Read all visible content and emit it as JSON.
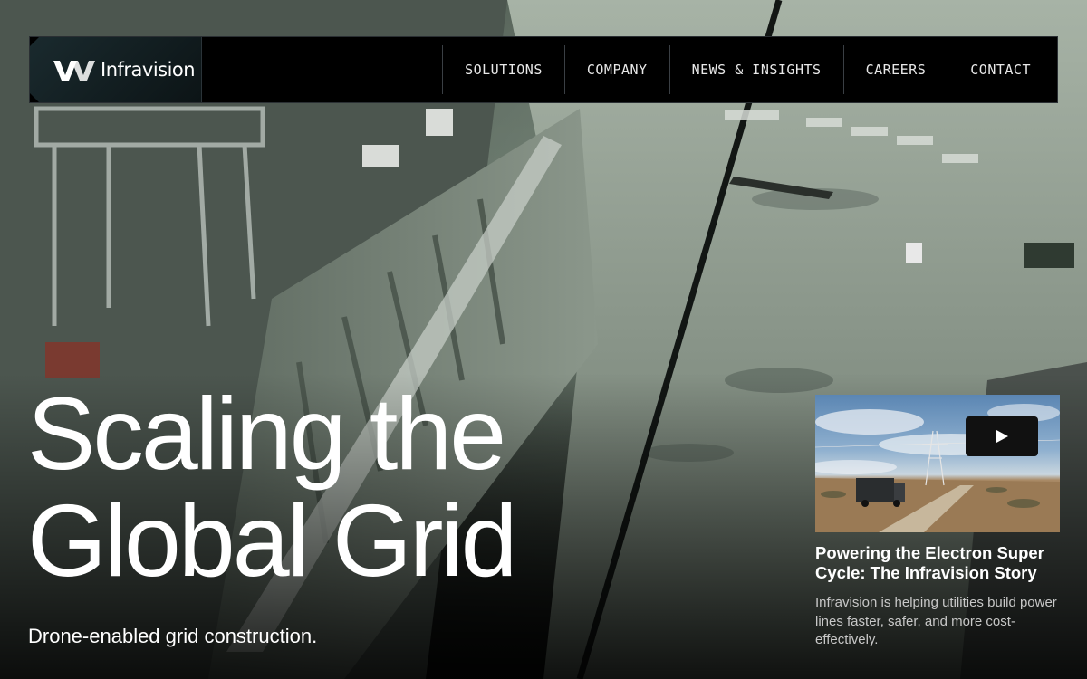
{
  "brand": {
    "name": "Infravision"
  },
  "nav": {
    "items": [
      {
        "label": "SOLUTIONS"
      },
      {
        "label": "COMPANY"
      },
      {
        "label": "NEWS & INSIGHTS"
      },
      {
        "label": "CAREERS"
      },
      {
        "label": "CONTACT"
      }
    ]
  },
  "hero": {
    "headline_line1": "Scaling the",
    "headline_line2": "Global Grid",
    "subheadline": "Drone-enabled grid construction."
  },
  "video_card": {
    "title": "Powering the Electron Super Cycle: The Infravision Story",
    "description": "Infravision is helping utilities build power lines faster, safer, and more cost-effectively.",
    "play_icon": "play-icon"
  },
  "colors": {
    "nav_background": "#000000",
    "text_primary": "#ffffff",
    "text_secondary": "#c8c8c8"
  }
}
